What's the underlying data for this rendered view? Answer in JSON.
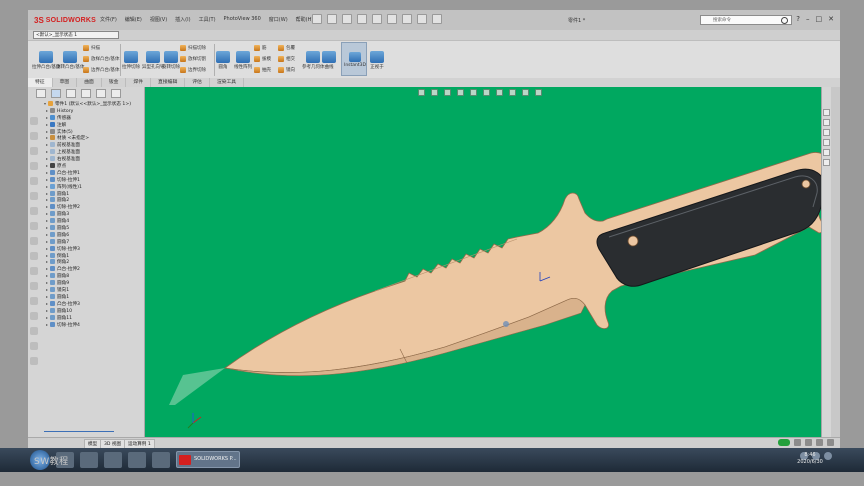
{
  "app": {
    "brand_prefix": "3S",
    "brand_name": "SOLIDWORKS",
    "menus": [
      "文件(F)",
      "编辑(E)",
      "视图(V)",
      "插入(I)",
      "工具(T)",
      "PhotoView 360",
      "窗口(W)",
      "帮助(H)"
    ],
    "document_title": "零件1 *",
    "search_placeholder": "搜索命令",
    "window_controls": [
      "?",
      "–",
      "□",
      "✕"
    ]
  },
  "config": {
    "selector_value": "<默认>_显示状态 1"
  },
  "ribbon": {
    "large_buttons": [
      "拉伸凸台/基体",
      "旋转凸台/基体",
      "拉伸切除",
      "异型孔向导",
      "旋转切除",
      "圆角",
      "线性阵列",
      "筋",
      "参考几何体",
      "曲线",
      "Instant3D",
      "正视于"
    ],
    "small_buttons": [
      "扫描",
      "放样凸台/基体",
      "边界凸台/基体",
      "扫描切除",
      "放样切割",
      "边界切除",
      "拔模",
      "抽壳",
      "包覆",
      "相交",
      "镜向"
    ]
  },
  "tabs": [
    "特征",
    "草图",
    "曲面",
    "钣金",
    "焊件",
    "直接编辑",
    "评估",
    "渲染工具"
  ],
  "active_tab": "特征",
  "feature_tree": [
    {
      "label": "零件1 (默认<<默认>_显示状态 1>)",
      "icon": "part-icon",
      "level": 0
    },
    {
      "label": "History",
      "icon": "history-icon",
      "level": 1
    },
    {
      "label": "传感器",
      "icon": "sensor-icon",
      "level": 1
    },
    {
      "label": "注解",
      "icon": "annotation-icon",
      "level": 1
    },
    {
      "label": "实体(5)",
      "icon": "solid-bodies-icon",
      "level": 1
    },
    {
      "label": "材质 <未指定>",
      "icon": "material-icon",
      "level": 1
    },
    {
      "label": "前视基准面",
      "icon": "plane-icon",
      "level": 1
    },
    {
      "label": "上视基准面",
      "icon": "plane-icon",
      "level": 1
    },
    {
      "label": "右视基准面",
      "icon": "plane-icon",
      "level": 1
    },
    {
      "label": "原点",
      "icon": "origin-icon",
      "level": 1
    },
    {
      "label": "凸台-拉伸1",
      "icon": "extrude-icon",
      "level": 1
    },
    {
      "label": "切除-拉伸1",
      "icon": "cut-icon",
      "level": 1
    },
    {
      "label": "阵列(线性)1",
      "icon": "pattern-icon",
      "level": 1
    },
    {
      "label": "圆角1",
      "icon": "fillet-icon",
      "level": 1
    },
    {
      "label": "圆角2",
      "icon": "fillet-icon",
      "level": 1
    },
    {
      "label": "切除-拉伸2",
      "icon": "cut-icon",
      "level": 1
    },
    {
      "label": "圆角3",
      "icon": "fillet-icon",
      "level": 1
    },
    {
      "label": "圆角4",
      "icon": "fillet-icon",
      "level": 1
    },
    {
      "label": "圆角5",
      "icon": "fillet-icon",
      "level": 1
    },
    {
      "label": "圆角6",
      "icon": "fillet-icon",
      "level": 1
    },
    {
      "label": "圆角7",
      "icon": "fillet-icon",
      "level": 1
    },
    {
      "label": "切除-拉伸3",
      "icon": "cut-icon",
      "level": 1
    },
    {
      "label": "倒角1",
      "icon": "chamfer-icon",
      "level": 1
    },
    {
      "label": "倒角2",
      "icon": "chamfer-icon",
      "level": 1
    },
    {
      "label": "凸台-拉伸2",
      "icon": "extrude-icon",
      "level": 1
    },
    {
      "label": "圆角8",
      "icon": "fillet-icon",
      "level": 1
    },
    {
      "label": "圆角9",
      "icon": "fillet-icon",
      "level": 1
    },
    {
      "label": "镜向1",
      "icon": "mirror-icon",
      "level": 1
    },
    {
      "label": "圆角1",
      "icon": "fillet-icon",
      "level": 1
    },
    {
      "label": "凸台-拉伸3",
      "icon": "extrude-icon",
      "level": 1
    },
    {
      "label": "圆角10",
      "icon": "fillet-icon",
      "level": 1
    },
    {
      "label": "圆角11",
      "icon": "fillet-icon",
      "level": 1
    },
    {
      "label": "切除-拉伸4",
      "icon": "cut-icon",
      "level": 1
    }
  ],
  "sheet_tabs": [
    "模型",
    "3D 视图",
    "运动算例 1"
  ],
  "taskbar": {
    "watermark": "SW教程",
    "sw_task_label": "SOLIDWORKS P...",
    "clock_time": "8:46",
    "clock_date": "2020/6/30"
  },
  "colors": {
    "viewport_bg": "#00a860",
    "blade": "#ecc7a2",
    "handle": "#2a2d30",
    "brand_red": "#d41f1f"
  }
}
